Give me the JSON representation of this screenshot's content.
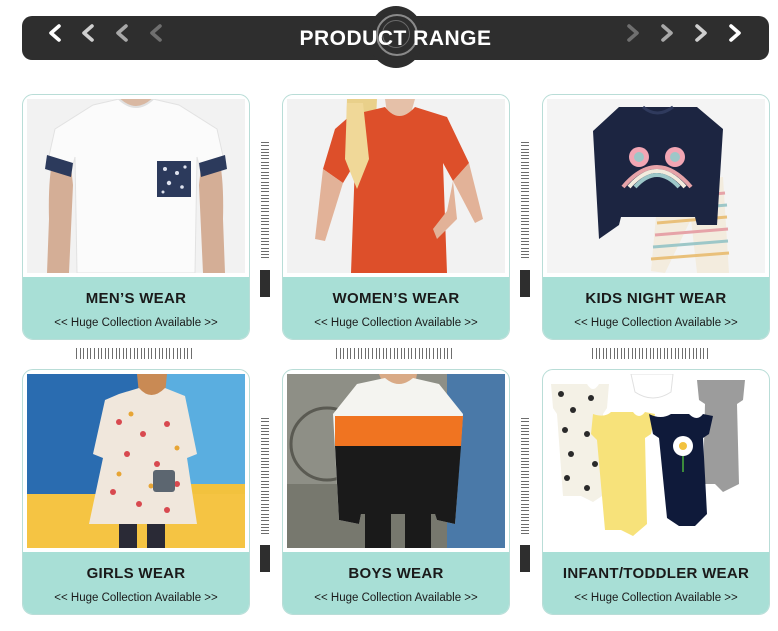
{
  "header": {
    "title": "PRODUCT RANGE",
    "left_arrows": [
      "chevron-left-icon",
      "chevron-left-icon",
      "chevron-left-icon",
      "chevron-left-icon"
    ],
    "right_arrows": [
      "chevron-right-icon",
      "chevron-right-icon",
      "chevron-right-icon",
      "chevron-right-icon"
    ]
  },
  "colors": {
    "banner": "#2e2e2e",
    "card_band": "#a8dfd6",
    "card_border": "#b9ddd7"
  },
  "products": [
    {
      "title": "MEN’S WEAR",
      "subtitle": "<< Huge Collection Available >>",
      "image": "mens-tshirt-image"
    },
    {
      "title": "WOMEN’S WEAR",
      "subtitle": "<< Huge Collection Available >>",
      "image": "womens-top-image"
    },
    {
      "title": "KIDS NIGHT WEAR",
      "subtitle": "<< Huge Collection Available >>",
      "image": "kids-pajama-image"
    },
    {
      "title": "GIRLS WEAR",
      "subtitle": "<< Huge Collection Available >>",
      "image": "girls-dress-image"
    },
    {
      "title": "BOYS WEAR",
      "subtitle": "<< Huge Collection Available >>",
      "image": "boys-sweatshirt-image"
    },
    {
      "title": "INFANT/TODDLER WEAR",
      "subtitle": "<< Huge Collection Available >>",
      "image": "infant-bodysuits-image"
    }
  ]
}
